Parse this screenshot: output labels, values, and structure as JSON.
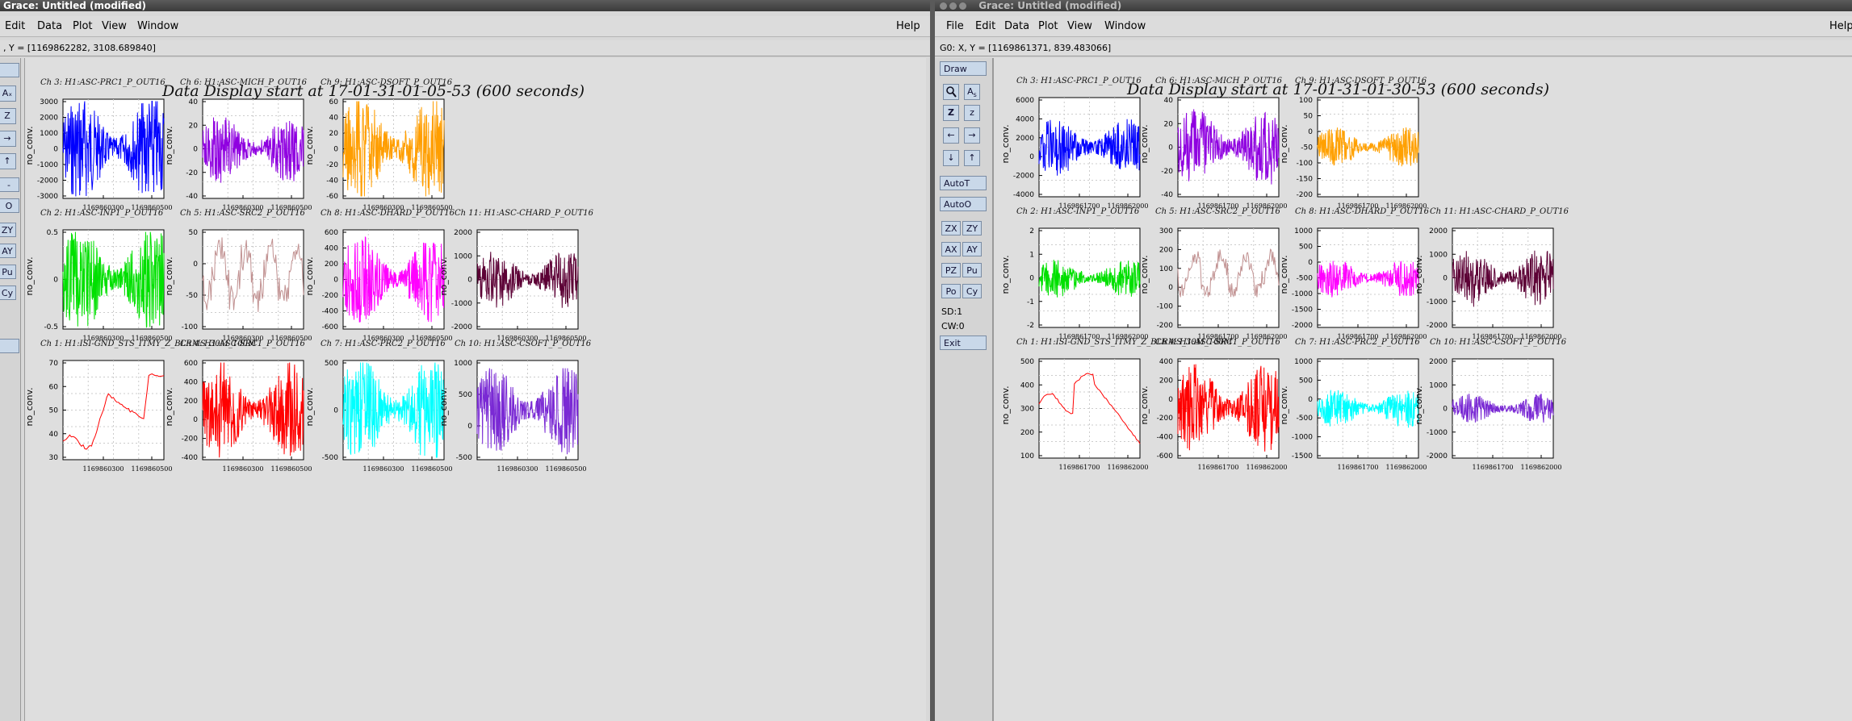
{
  "left": {
    "title": "Grace: Untitled (modified)",
    "menu": [
      "Edit",
      "Data",
      "Plot",
      "View",
      "Window"
    ],
    "help": "Help",
    "locator": ", Y = [1169862282, 3108.689840]",
    "plot_title": "Data Display start at 17-01-31-01-05-53 (600 seconds)",
    "tools": [
      "Aₓ",
      "Z",
      "→",
      "↑",
      "-",
      "O",
      "ZY",
      "AY",
      "Pu",
      "Cy"
    ],
    "xticks": [
      "1169860300",
      "1169860500"
    ],
    "panels": [
      {
        "title": "Ch 3: H1:ASC-PRC1_P_OUT16",
        "color": "#0000ff",
        "yticks": [
          "3000",
          "2000",
          "1000",
          "0",
          "-1000",
          "-2000",
          "-3000"
        ],
        "kind": "noise",
        "amp": 0.55
      },
      {
        "title": "Ch 6: H1:ASC-MICH_P_OUT16",
        "color": "#8f00e0",
        "yticks": [
          "40",
          "20",
          "0",
          "-20",
          "-40"
        ],
        "kind": "noise",
        "amp": 0.35
      },
      {
        "title": "Ch 9: H1:ASC-DSOFT_P_OUT16",
        "color": "#ff9e00",
        "yticks": [
          "60",
          "40",
          "20",
          "0",
          "-20",
          "-40",
          "-60"
        ],
        "kind": "noise",
        "amp": 0.55
      },
      null,
      {
        "title": "Ch 2: H1:ASC-INP1_P_OUT16",
        "color": "#00e000",
        "yticks": [
          "0.5",
          "0",
          "-0.5"
        ],
        "kind": "noise",
        "amp": 0.55
      },
      {
        "title": "Ch 5: H1:ASC-SRC2_P_OUT16",
        "color": "#c09090",
        "yticks": [
          "50",
          "0",
          "-50",
          "-100"
        ],
        "kind": "slow",
        "amp": 0.45
      },
      {
        "title": "Ch 8: H1:ASC-DHARD_P_OUT16",
        "color": "#ff00ff",
        "yticks": [
          "600",
          "400",
          "200",
          "0",
          "-200",
          "-400",
          "-600"
        ],
        "kind": "noise",
        "amp": 0.45
      },
      {
        "title": "Ch 11: H1:ASC-CHARD_P_OUT16",
        "color": "#5c0035",
        "yticks": [
          "2000",
          "1000",
          "0",
          "-1000",
          "-2000"
        ],
        "kind": "noise",
        "amp": 0.3
      },
      {
        "title": "Ch 1: H1:ISI-GND_STS_ITMY_Z_BLRMS_30M_100M",
        "color": "#ff0000",
        "yticks": [
          "70",
          "60",
          "50",
          "40",
          "30"
        ],
        "kind": "trend1",
        "amp": 0
      },
      {
        "title": "Ch 4: H1:ASC-SRC1_P_OUT16",
        "color": "#ff0000",
        "yticks": [
          "600",
          "400",
          "200",
          "0",
          "-200",
          "-400"
        ],
        "kind": "redn",
        "amp": 0.5
      },
      {
        "title": "Ch 7: H1:ASC-PRC2_P_OUT16",
        "color": "#00ffff",
        "yticks": [
          "500",
          "0",
          "-500"
        ],
        "kind": "noise",
        "amp": 0.55
      },
      {
        "title": "Ch 10: H1:ASC-CSOFT_P_OUT16",
        "color": "#7a2ad4",
        "yticks": [
          "1000",
          "500",
          "0",
          "-500"
        ],
        "kind": "noise",
        "amp": 0.45
      }
    ]
  },
  "right": {
    "title": "Grace: Untitled (modified)",
    "menu": [
      "File",
      "Edit",
      "Data",
      "Plot",
      "View",
      "Window"
    ],
    "help": "Help",
    "locator": "G0: X, Y = [1169861371, 839.483066]",
    "plot_title": "Data Display start at 17-01-31-01-30-53 (600 seconds)",
    "tools": {
      "draw": "Draw",
      "autot": "AutoT",
      "autoo": "AutoO",
      "zx": "ZX",
      "zy": "ZY",
      "ax": "AX",
      "ay": "AY",
      "pz": "PZ",
      "pu": "Pu",
      "po": "Po",
      "cy": "Cy",
      "sd": "SD:1",
      "cw": "CW:0",
      "exit": "Exit"
    },
    "xticks": [
      "1169861700",
      "1169862000"
    ],
    "panels": [
      {
        "title": "Ch 3: H1:ASC-PRC1_P_OUT16",
        "color": "#0000ff",
        "yticks": [
          "6000",
          "4000",
          "2000",
          "0",
          "-2000",
          "-4000"
        ],
        "kind": "noise",
        "amp": 0.3
      },
      {
        "title": "Ch 6: H1:ASC-MICH_P_OUT16",
        "color": "#8f00e0",
        "yticks": [
          "40",
          "20",
          "0",
          "-20",
          "-40"
        ],
        "kind": "noise",
        "amp": 0.4
      },
      {
        "title": "Ch 9: H1:ASC-DSOFT_P_OUT16",
        "color": "#ffa000",
        "yticks": [
          "100",
          "50",
          "0",
          "-50",
          "-100",
          "-150",
          "-200"
        ],
        "kind": "noise",
        "amp": 0.2
      },
      null,
      {
        "title": "Ch 2: H1:ASC-INP1_P_OUT16",
        "color": "#00e000",
        "yticks": [
          "2",
          "1",
          "0",
          "-1",
          "-2"
        ],
        "kind": "noise",
        "amp": 0.2
      },
      {
        "title": "Ch 5: H1:ASC-SRC2_P_OUT16",
        "color": "#c09090",
        "yticks": [
          "300",
          "200",
          "100",
          "0",
          "-100",
          "-200"
        ],
        "kind": "slow",
        "amp": 0.3
      },
      {
        "title": "Ch 8: H1:ASC-DHARD_P_OUT16",
        "color": "#ff00ff",
        "yticks": [
          "1000",
          "500",
          "0",
          "-500",
          "-1000",
          "-1500",
          "-2000"
        ],
        "kind": "noise",
        "amp": 0.2
      },
      {
        "title": "Ch 11: H1:ASC-CHARD_P_OUT16",
        "color": "#5c0035",
        "yticks": [
          "2000",
          "1000",
          "0",
          "-1000",
          "-2000"
        ],
        "kind": "noise",
        "amp": 0.3
      },
      {
        "title": "Ch 1: H1:ISI-GND_STS_ITMY_Z_BLRMS_30M_100M",
        "color": "#ff0000",
        "yticks": [
          "500",
          "400",
          "300",
          "200",
          "100"
        ],
        "kind": "trend2",
        "amp": 0
      },
      {
        "title": "Ch 4: H1:ASC-SRC1_P_OUT16",
        "color": "#ff0000",
        "yticks": [
          "400",
          "200",
          "0",
          "-200",
          "-400",
          "-600"
        ],
        "kind": "redn",
        "amp": 0.45
      },
      {
        "title": "Ch 7: H1:ASC-PRC2_P_OUT16",
        "color": "#00ffff",
        "yticks": [
          "1000",
          "500",
          "0",
          "-500",
          "-1000",
          "-1500"
        ],
        "kind": "noise",
        "amp": 0.2
      },
      {
        "title": "Ch 10: H1:ASC-CSOFT_P_OUT16",
        "color": "#7a2ad4",
        "yticks": [
          "2000",
          "1000",
          "0",
          "-1000",
          "-2000"
        ],
        "kind": "noise",
        "amp": 0.15
      }
    ]
  },
  "ylabel": "no_conv."
}
